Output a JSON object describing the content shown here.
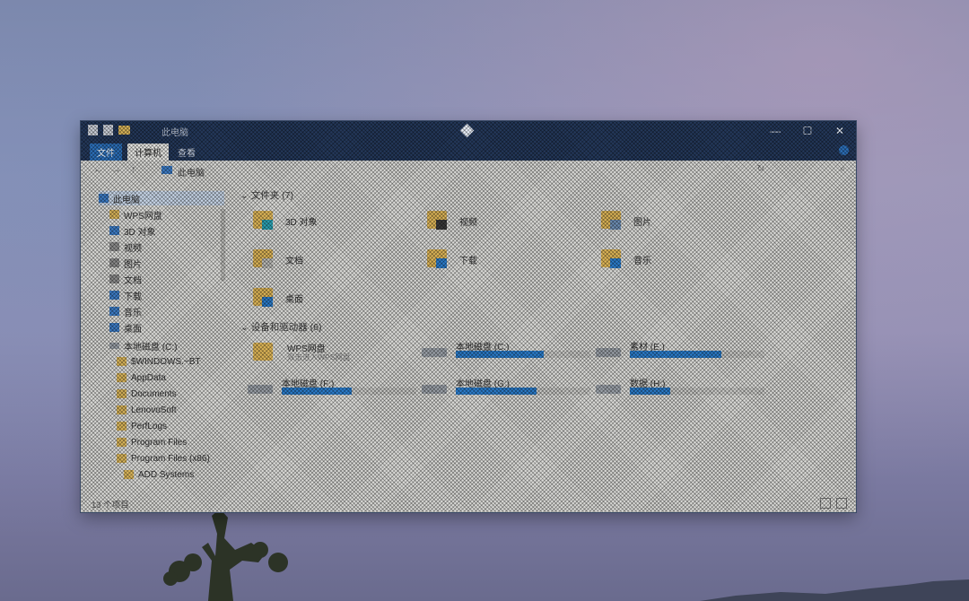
{
  "window": {
    "title": "此电脑",
    "controls": {
      "minimize": "—",
      "maximize": "☐",
      "close": "✕"
    }
  },
  "ribbon": {
    "tabs": [
      "文件",
      "计算机",
      "查看"
    ]
  },
  "address": {
    "path": "此电脑",
    "back": "←",
    "forward": "→",
    "up": "↑",
    "refresh": "↻",
    "search": "⌕"
  },
  "nav": {
    "items": [
      {
        "label": "此电脑",
        "icon": "pc-icon"
      },
      {
        "label": "WPS网盘",
        "icon": "cloud-folder-icon"
      },
      {
        "label": "3D 对象",
        "icon": "3d-objects-icon"
      },
      {
        "label": "视频",
        "icon": "video-icon"
      },
      {
        "label": "图片",
        "icon": "pictures-icon"
      },
      {
        "label": "文档",
        "icon": "documents-icon"
      },
      {
        "label": "下载",
        "icon": "download-icon"
      },
      {
        "label": "音乐",
        "icon": "music-icon"
      },
      {
        "label": "桌面",
        "icon": "desktop-icon"
      },
      {
        "label": "本地磁盘 (C:)",
        "icon": "drive-icon"
      },
      {
        "label": "$WINDOWS.~BT",
        "icon": "folder-icon"
      },
      {
        "label": "AppData",
        "icon": "folder-icon"
      },
      {
        "label": "Documents",
        "icon": "folder-icon"
      },
      {
        "label": "LenovoSoft",
        "icon": "folder-icon"
      },
      {
        "label": "PerfLogs",
        "icon": "folder-icon"
      },
      {
        "label": "Program Files",
        "icon": "folder-icon"
      },
      {
        "label": "Program Files (x86)",
        "icon": "folder-icon"
      },
      {
        "label": "ADD Systems",
        "icon": "folder-icon"
      }
    ]
  },
  "folders_header": "文件夹 (7)",
  "folders": [
    {
      "label": "3D 对象",
      "icon": "3d-objects-icon"
    },
    {
      "label": "视频",
      "icon": "video-icon"
    },
    {
      "label": "图片",
      "icon": "pictures-icon"
    },
    {
      "label": "文档",
      "icon": "documents-icon"
    },
    {
      "label": "下载",
      "icon": "download-icon"
    },
    {
      "label": "音乐",
      "icon": "music-icon"
    },
    {
      "label": "桌面",
      "icon": "desktop-icon"
    }
  ],
  "devices_header": "设备和驱动器 (6)",
  "devices": [
    {
      "label": "WPS网盘",
      "sub": "双击进入WPS网盘",
      "icon": "cloud-folder-icon",
      "usage": null
    },
    {
      "label": "本地磁盘 (C:)",
      "sub": "",
      "icon": "drive-icon",
      "usage": 0.65
    },
    {
      "label": "素材 (E:)",
      "sub": "",
      "icon": "drive-icon",
      "usage": 0.68
    },
    {
      "label": "本地磁盘 (F:)",
      "sub": "",
      "icon": "drive-icon",
      "usage": 0.52
    },
    {
      "label": "本地磁盘 (G:)",
      "sub": "",
      "icon": "drive-icon",
      "usage": 0.6
    },
    {
      "label": "数据 (H:)",
      "sub": "",
      "icon": "drive-icon",
      "usage": 0.3
    }
  ],
  "status": {
    "count": "13 个项目"
  },
  "colors": {
    "titlebar": "#24385a",
    "accent": "#2a7bc9",
    "folder": "#dcb457"
  }
}
